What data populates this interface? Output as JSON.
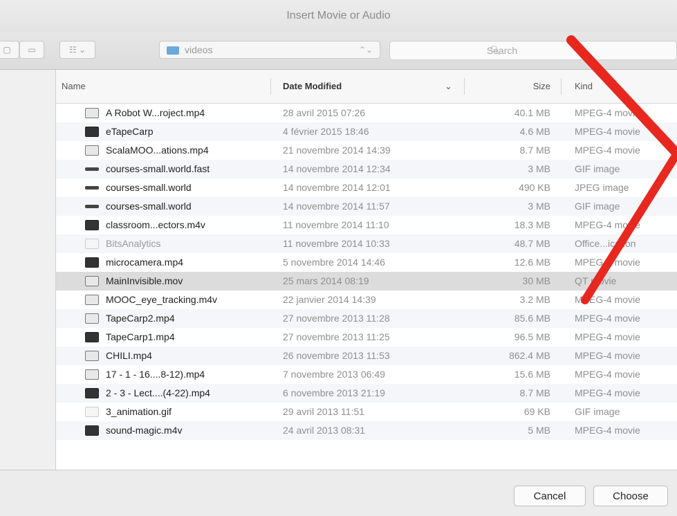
{
  "window": {
    "title": "Insert Movie or Audio"
  },
  "toolbar": {
    "view_icons_label": "",
    "view_list_label": "",
    "arrange_label": "☷ ⌄",
    "location": "videos",
    "location_arrows": "⌃⌄",
    "search_placeholder": "Search"
  },
  "columns": {
    "name": "Name",
    "date": "Date Modified",
    "sort_indicator": "⌄",
    "size": "Size",
    "kind": "Kind"
  },
  "files": [
    {
      "name": "A Robot W...roject.mp4",
      "date": "28 avril 2015 07:26",
      "size": "40.1 MB",
      "kind": "MPEG-4 movie",
      "icon": "movie-file-icon"
    },
    {
      "name": "eTapeCarp",
      "date": "4 février 2015 18:46",
      "size": "4.6 MB",
      "kind": "MPEG-4 movie",
      "icon": "movie-thumbnail-icon"
    },
    {
      "name": "ScalaMOO...ations.mp4",
      "date": "21 novembre 2014 14:39",
      "size": "8.7 MB",
      "kind": "MPEG-4 movie",
      "icon": "movie-file-icon"
    },
    {
      "name": "courses-small.world.fast",
      "date": "14 novembre 2014 12:34",
      "size": "3 MB",
      "kind": "GIF image",
      "icon": "image-strip-icon"
    },
    {
      "name": "courses-small.world",
      "date": "14 novembre 2014 12:01",
      "size": "490 KB",
      "kind": "JPEG image",
      "icon": "image-strip-icon"
    },
    {
      "name": "courses-small.world",
      "date": "14 novembre 2014 11:57",
      "size": "3 MB",
      "kind": "GIF image",
      "icon": "image-strip-icon"
    },
    {
      "name": "classroom...ectors.m4v",
      "date": "11 novembre 2014 11:10",
      "size": "18.3 MB",
      "kind": "MPEG-4 movie",
      "icon": "movie-thumbnail-icon"
    },
    {
      "name": "BitsAnalytics",
      "date": "11 novembre 2014 10:33",
      "size": "48.7 MB",
      "kind": "Office...ication",
      "icon": "document-icon",
      "dim": true
    },
    {
      "name": "microcamera.mp4",
      "date": "5 novembre 2014 14:46",
      "size": "12.6 MB",
      "kind": "MPEG-4 movie",
      "icon": "movie-thumbnail-icon"
    },
    {
      "name": "MainInvisible.mov",
      "date": "25 mars 2014 08:19",
      "size": "30 MB",
      "kind": "QT movie",
      "icon": "movie-file-icon",
      "selected": true
    },
    {
      "name": "MOOC_eye_tracking.m4v",
      "date": "22 janvier 2014 14:39",
      "size": "3.2 MB",
      "kind": "MPEG-4 movie",
      "icon": "movie-file-icon"
    },
    {
      "name": "TapeCarp2.mp4",
      "date": "27 novembre 2013 11:28",
      "size": "85.6 MB",
      "kind": "MPEG-4 movie",
      "icon": "movie-file-icon"
    },
    {
      "name": "TapeCarp1.mp4",
      "date": "27 novembre 2013 11:25",
      "size": "96.5 MB",
      "kind": "MPEG-4 movie",
      "icon": "movie-thumbnail-icon"
    },
    {
      "name": "CHILI.mp4",
      "date": "26 novembre 2013 11:53",
      "size": "862.4 MB",
      "kind": "MPEG-4 movie",
      "icon": "movie-file-icon"
    },
    {
      "name": "17 - 1 - 16....8-12).mp4",
      "date": "7 novembre 2013 06:49",
      "size": "15.6 MB",
      "kind": "MPEG-4 movie",
      "icon": "movie-file-icon"
    },
    {
      "name": "2 - 3 - Lect....(4-22).mp4",
      "date": "6 novembre 2013 21:19",
      "size": "8.7 MB",
      "kind": "MPEG-4 movie",
      "icon": "movie-thumbnail-icon"
    },
    {
      "name": "3_animation.gif",
      "date": "29 avril 2013 11:51",
      "size": "69 KB",
      "kind": "GIF image",
      "icon": "gif-file-icon"
    },
    {
      "name": "sound-magic.m4v",
      "date": "24 avril 2013 08:31",
      "size": "5 MB",
      "kind": "MPEG-4 movie",
      "icon": "movie-thumbnail-icon"
    }
  ],
  "footer": {
    "cancel_label": "Cancel",
    "choose_label": "Choose"
  },
  "colors": {
    "annotation": "#e8281f",
    "folder": "#6aa9dc",
    "selected_row": "#dcdcdc"
  }
}
